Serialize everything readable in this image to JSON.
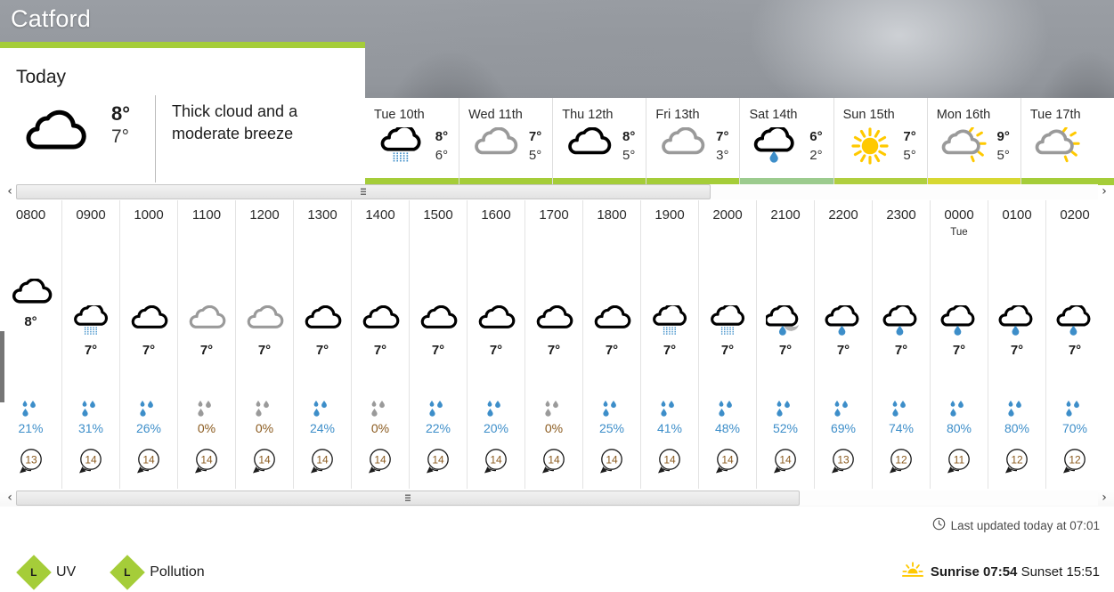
{
  "header": {
    "city": "Catford"
  },
  "today": {
    "label": "Today",
    "icon": "cloudy-icon",
    "high": "8°",
    "low": "7°",
    "description": "Thick cloud and a moderate breeze"
  },
  "daily": [
    {
      "day": "Tue 10th",
      "icon": "light-rain-icon",
      "high": "8°",
      "low": "6°",
      "bar_color": "#a5cd39"
    },
    {
      "day": "Wed 11th",
      "icon": "cloudy-grey-icon",
      "high": "7°",
      "low": "5°",
      "bar_color": "#a5cd39"
    },
    {
      "day": "Thu 12th",
      "icon": "cloudy-icon",
      "high": "8°",
      "low": "5°",
      "bar_color": "#a5cd39"
    },
    {
      "day": "Fri 13th",
      "icon": "cloudy-grey-icon",
      "high": "7°",
      "low": "3°",
      "bar_color": "#a5cd39"
    },
    {
      "day": "Sat 14th",
      "icon": "rain-shower-icon",
      "high": "6°",
      "low": "2°",
      "bar_color": "#9ccb8e"
    },
    {
      "day": "Sun 15th",
      "icon": "sunny-icon",
      "high": "7°",
      "low": "5°",
      "bar_color": "#b0cf3f"
    },
    {
      "day": "Mon 16th",
      "icon": "sunny-intervals-icon",
      "high": "9°",
      "low": "5°",
      "bar_color": "#d7d832"
    },
    {
      "day": "Tue 17th",
      "icon": "sunny-intervals-icon",
      "high": "",
      "low": "",
      "bar_color": "#a5cd39"
    }
  ],
  "hourly": [
    {
      "time": "0800",
      "sub": "",
      "icon": "cloudy-icon",
      "temp": "8°",
      "precip": "21%",
      "precip_active": true,
      "wind": "13",
      "now": true
    },
    {
      "time": "0900",
      "sub": "",
      "icon": "light-rain-icon",
      "temp": "7°",
      "precip": "31%",
      "precip_active": true,
      "wind": "14",
      "now": false
    },
    {
      "time": "1000",
      "sub": "",
      "icon": "cloudy-icon",
      "temp": "7°",
      "precip": "26%",
      "precip_active": true,
      "wind": "14",
      "now": false
    },
    {
      "time": "1100",
      "sub": "",
      "icon": "cloudy-grey-icon",
      "temp": "7°",
      "precip": "0%",
      "precip_active": false,
      "wind": "14",
      "now": false
    },
    {
      "time": "1200",
      "sub": "",
      "icon": "cloudy-grey-icon",
      "temp": "7°",
      "precip": "0%",
      "precip_active": false,
      "wind": "14",
      "now": false
    },
    {
      "time": "1300",
      "sub": "",
      "icon": "cloudy-icon",
      "temp": "7°",
      "precip": "24%",
      "precip_active": true,
      "wind": "14",
      "now": false
    },
    {
      "time": "1400",
      "sub": "",
      "icon": "cloudy-icon",
      "temp": "7°",
      "precip": "0%",
      "precip_active": false,
      "wind": "14",
      "now": false
    },
    {
      "time": "1500",
      "sub": "",
      "icon": "cloudy-icon",
      "temp": "7°",
      "precip": "22%",
      "precip_active": true,
      "wind": "14",
      "now": false
    },
    {
      "time": "1600",
      "sub": "",
      "icon": "cloudy-icon",
      "temp": "7°",
      "precip": "20%",
      "precip_active": true,
      "wind": "14",
      "now": false
    },
    {
      "time": "1700",
      "sub": "",
      "icon": "cloudy-icon",
      "temp": "7°",
      "precip": "0%",
      "precip_active": false,
      "wind": "14",
      "now": false
    },
    {
      "time": "1800",
      "sub": "",
      "icon": "cloudy-icon",
      "temp": "7°",
      "precip": "25%",
      "precip_active": true,
      "wind": "14",
      "now": false
    },
    {
      "time": "1900",
      "sub": "",
      "icon": "light-rain-icon",
      "temp": "7°",
      "precip": "41%",
      "precip_active": true,
      "wind": "14",
      "now": false
    },
    {
      "time": "2000",
      "sub": "",
      "icon": "light-rain-icon",
      "temp": "7°",
      "precip": "48%",
      "precip_active": true,
      "wind": "14",
      "now": false
    },
    {
      "time": "2100",
      "sub": "",
      "icon": "rain-shower-night-icon",
      "temp": "7°",
      "precip": "52%",
      "precip_active": true,
      "wind": "14",
      "now": false
    },
    {
      "time": "2200",
      "sub": "",
      "icon": "rain-shower-icon",
      "temp": "7°",
      "precip": "69%",
      "precip_active": true,
      "wind": "13",
      "now": false
    },
    {
      "time": "2300",
      "sub": "",
      "icon": "rain-shower-icon",
      "temp": "7°",
      "precip": "74%",
      "precip_active": true,
      "wind": "12",
      "now": false
    },
    {
      "time": "0000",
      "sub": "Tue",
      "icon": "rain-shower-icon",
      "temp": "7°",
      "precip": "80%",
      "precip_active": true,
      "wind": "11",
      "now": false
    },
    {
      "time": "0100",
      "sub": "",
      "icon": "rain-shower-icon",
      "temp": "7°",
      "precip": "80%",
      "precip_active": true,
      "wind": "12",
      "now": false
    },
    {
      "time": "0200",
      "sub": "",
      "icon": "rain-shower-icon",
      "temp": "7°",
      "precip": "70%",
      "precip_active": true,
      "wind": "12",
      "now": false
    }
  ],
  "footer": {
    "updated_text": "Last updated today at 07:01",
    "updated_icon": "clock-icon",
    "sunrise_label": "Sunrise",
    "sunrise_time": "07:54",
    "sunset_label": "Sunset",
    "sunset_time": "15:51",
    "sun_icon": "sunrise-icon",
    "legend": [
      {
        "badge": "L",
        "label": "UV"
      },
      {
        "badge": "L",
        "label": "Pollution"
      }
    ]
  },
  "scrollbars": {
    "left_arrow": "‹",
    "right_arrow": "›"
  },
  "colors": {
    "accent_green": "#a5cd39",
    "precip_blue": "#3d8ec9",
    "precip_grey": "#9a9a9a",
    "sun_yellow": "#ffc900"
  }
}
